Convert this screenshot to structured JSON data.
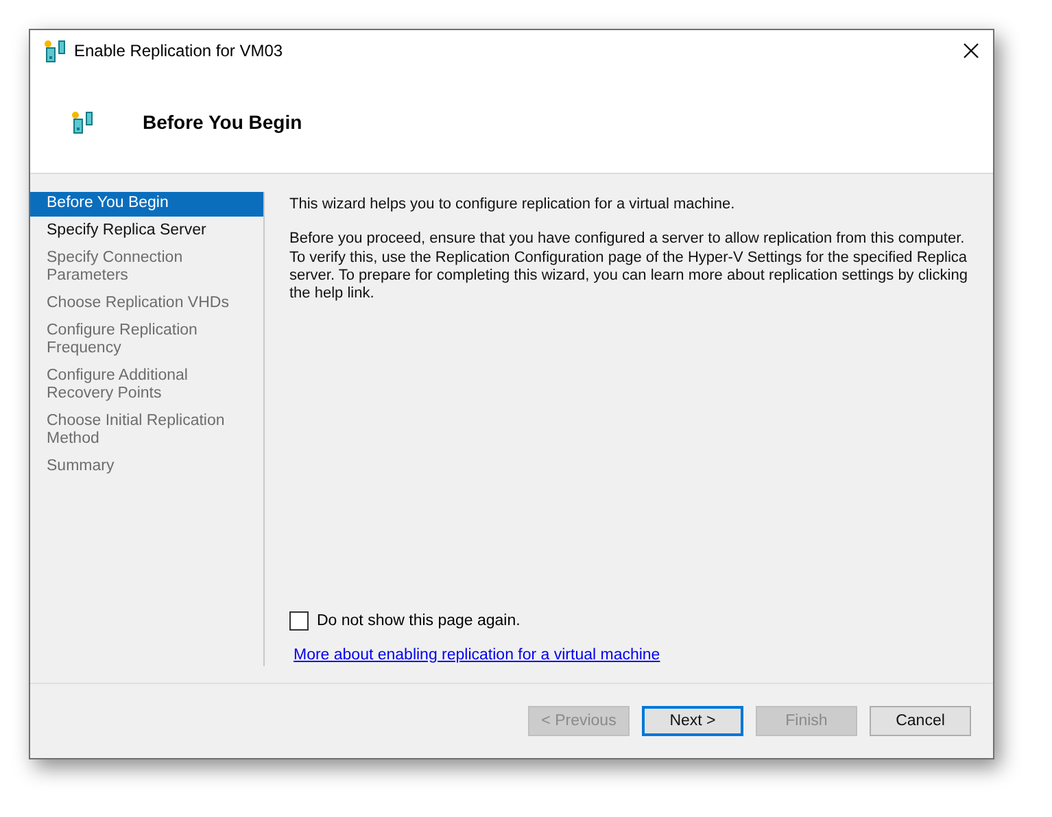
{
  "window": {
    "title": "Enable Replication for VM03"
  },
  "header": {
    "title": "Before You Begin"
  },
  "steps": [
    {
      "label": "Before You Begin",
      "selected": true,
      "disabled": false
    },
    {
      "label": "Specify Replica Server",
      "selected": false,
      "disabled": false
    },
    {
      "label": "Specify Connection Parameters",
      "selected": false,
      "disabled": true
    },
    {
      "label": "Choose Replication VHDs",
      "selected": false,
      "disabled": true
    },
    {
      "label": "Configure Replication Frequency",
      "selected": false,
      "disabled": true
    },
    {
      "label": "Configure Additional Recovery Points",
      "selected": false,
      "disabled": true
    },
    {
      "label": "Choose Initial Replication Method",
      "selected": false,
      "disabled": true
    },
    {
      "label": "Summary",
      "selected": false,
      "disabled": true
    }
  ],
  "paragraphs": [
    "This wizard helps you to configure replication for a virtual machine.",
    "Before you proceed, ensure that you have configured a server to allow replication from this computer. To verify this, use the Replication Configuration page of the Hyper-V Settings for the specified Replica server. To prepare for completing this wizard, you can learn more about replication settings by clicking the help link."
  ],
  "dont_show_again": {
    "label": "Do not show this page again.",
    "checked": false
  },
  "help_link": "More about enabling replication for a virtual machine",
  "buttons": [
    {
      "label": "< Previous",
      "disabled": true,
      "default": false
    },
    {
      "label": "Next >",
      "disabled": false,
      "default": true
    },
    {
      "label": "Finish",
      "disabled": true,
      "default": false
    },
    {
      "label": "Cancel",
      "disabled": false,
      "default": false
    }
  ]
}
